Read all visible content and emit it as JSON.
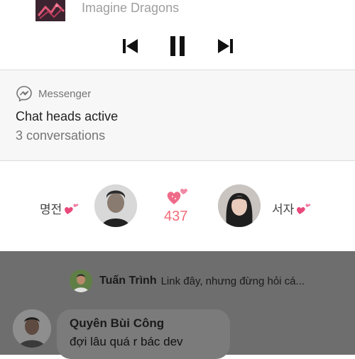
{
  "media": {
    "artist": "Imagine Dragons",
    "controls": {
      "previous": "previous-icon",
      "pause": "pause-icon",
      "next": "next-icon"
    }
  },
  "notification": {
    "app_name": "Messenger",
    "title": "Chat heads active",
    "subtitle": "3 conversations"
  },
  "couple": {
    "left_name": "명전",
    "right_name": "서자",
    "count": "437",
    "accent": "#f16c78"
  },
  "chat": {
    "row1": {
      "sender": "Tuấn Trình",
      "preview": "Link đây, nhưng đừng hỏi cá..."
    },
    "message": {
      "sender": "Quyên Bùi Công",
      "text": "đợi lâu quá r bác dev"
    }
  }
}
